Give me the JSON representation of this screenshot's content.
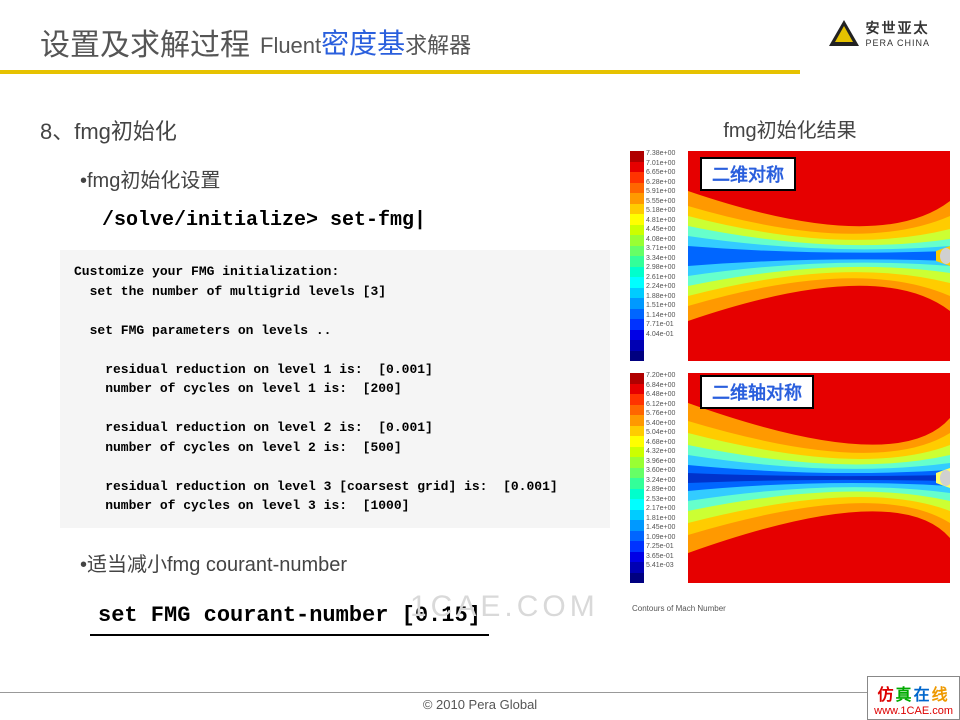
{
  "header": {
    "title_main": "设置及求解过程",
    "title_sub_prefix": "Fluent",
    "title_sub_blue": "密度基",
    "title_sub_suffix": "求解器",
    "logo_cn": "安世亚太",
    "logo_en": "PERA CHINA"
  },
  "section": {
    "number_label": "8、fmg初始化",
    "bullet1": "•fmg初始化设置",
    "cmd1": "/solve/initialize> set-fmg|",
    "code": "Customize your FMG initialization:\n  set the number of multigrid levels [3]\n\n  set FMG parameters on levels ..\n\n    residual reduction on level 1 is:  [0.001]\n    number of cycles on level 1 is:  [200]\n\n    residual reduction on level 2 is:  [0.001]\n    number of cycles on level 2 is:  [500]\n\n    residual reduction on level 3 [coarsest grid] is:  [0.001]\n    number of cycles on level 3 is:  [1000]",
    "bullet2": "•适当减小fmg courant-number",
    "cmd2": "set FMG courant-number [0.15]"
  },
  "right": {
    "title": "fmg初始化结果",
    "label1": "二维对称",
    "label2": "二维轴对称",
    "caption": "Contours of Mach Number",
    "colorbar1": [
      "7.38e+00",
      "7.01e+00",
      "6.65e+00",
      "6.28e+00",
      "5.91e+00",
      "5.55e+00",
      "5.18e+00",
      "4.81e+00",
      "4.45e+00",
      "4.08e+00",
      "3.71e+00",
      "3.34e+00",
      "2.98e+00",
      "2.61e+00",
      "2.24e+00",
      "1.88e+00",
      "1.51e+00",
      "1.14e+00",
      "7.71e-01",
      "4.04e-01"
    ],
    "colorbar2": [
      "7.20e+00",
      "6.84e+00",
      "6.48e+00",
      "6.12e+00",
      "5.76e+00",
      "5.40e+00",
      "5.04e+00",
      "4.68e+00",
      "4.32e+00",
      "3.96e+00",
      "3.60e+00",
      "3.24e+00",
      "2.89e+00",
      "2.53e+00",
      "2.17e+00",
      "1.81e+00",
      "1.45e+00",
      "1.09e+00",
      "7.25e-01",
      "3.65e-01",
      "5.41e-03"
    ]
  },
  "footer": "© 2010 Pera Global",
  "corner": {
    "c1": "仿",
    "c2": "真",
    "c3": "在",
    "c4": "线",
    "url": "www.1CAE.com"
  },
  "watermark": "1CAE.COM",
  "chart_data": [
    {
      "type": "heatmap",
      "title": "二维对称",
      "description": "Contours of Mach Number — 2D symmetric FMG initialization result",
      "value_label": "Mach Number",
      "range": [
        0.404,
        7.38
      ],
      "colorbar_values": [
        7.38,
        7.01,
        6.65,
        6.28,
        5.91,
        5.55,
        5.18,
        4.81,
        4.45,
        4.08,
        3.71,
        3.34,
        2.98,
        2.61,
        2.24,
        1.88,
        1.51,
        1.14,
        0.771,
        0.404
      ]
    },
    {
      "type": "heatmap",
      "title": "二维轴对称",
      "description": "Contours of Mach Number — 2D axisymmetric FMG initialization result",
      "value_label": "Mach Number",
      "range": [
        0.00541,
        7.2
      ],
      "colorbar_values": [
        7.2,
        6.84,
        6.48,
        6.12,
        5.76,
        5.4,
        5.04,
        4.68,
        4.32,
        3.96,
        3.6,
        3.24,
        2.89,
        2.53,
        2.17,
        1.81,
        1.45,
        1.09,
        0.725,
        0.365,
        0.00541
      ]
    }
  ]
}
